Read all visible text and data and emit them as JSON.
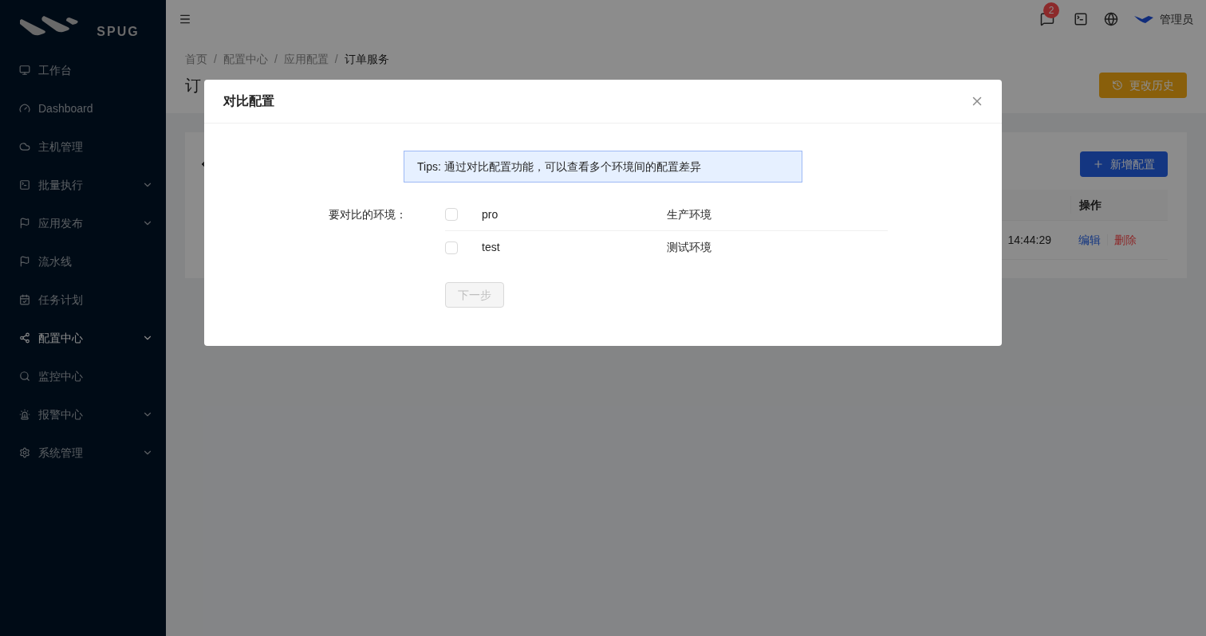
{
  "sidebar": {
    "logo_text": "SPUG",
    "items": [
      {
        "label": "工作台",
        "has_submenu": false,
        "selected": false
      },
      {
        "label": "Dashboard",
        "has_submenu": false,
        "selected": false
      },
      {
        "label": "主机管理",
        "has_submenu": false,
        "selected": false
      },
      {
        "label": "批量执行",
        "has_submenu": true,
        "selected": false
      },
      {
        "label": "应用发布",
        "has_submenu": true,
        "selected": false
      },
      {
        "label": "流水线",
        "has_submenu": false,
        "selected": false
      },
      {
        "label": "任务计划",
        "has_submenu": false,
        "selected": false
      },
      {
        "label": "配置中心",
        "has_submenu": true,
        "selected": true
      },
      {
        "label": "监控中心",
        "has_submenu": false,
        "selected": false
      },
      {
        "label": "报警中心",
        "has_submenu": true,
        "selected": false
      },
      {
        "label": "系统管理",
        "has_submenu": true,
        "selected": false
      }
    ]
  },
  "header": {
    "notification_count": "2",
    "user": "管理员"
  },
  "breadcrumb": [
    {
      "label": "首页"
    },
    {
      "separator": "/",
      "label": "配置中心"
    },
    {
      "separator": "/",
      "label": "应用配置"
    },
    {
      "separator": "/",
      "label": "订单服务"
    }
  ],
  "page_title": "订",
  "history_button": "更改历史",
  "add_button": "新增配置",
  "table": {
    "columns": [
      "操作"
    ],
    "rows": [
      {
        "time": "14:44:29",
        "actions": [
          "编辑",
          "删除"
        ]
      }
    ]
  },
  "modal": {
    "title": "对比配置",
    "tips": "Tips: 通过对比配置功能，可以查看多个环境间的配置差异",
    "field_label": "要对比的环境：",
    "environments": [
      {
        "key": "pro",
        "name": "生产环境",
        "checked": false
      },
      {
        "key": "test",
        "name": "测试环境",
        "checked": false
      }
    ],
    "next_button": {
      "label": "下一步",
      "disabled": true
    }
  }
}
